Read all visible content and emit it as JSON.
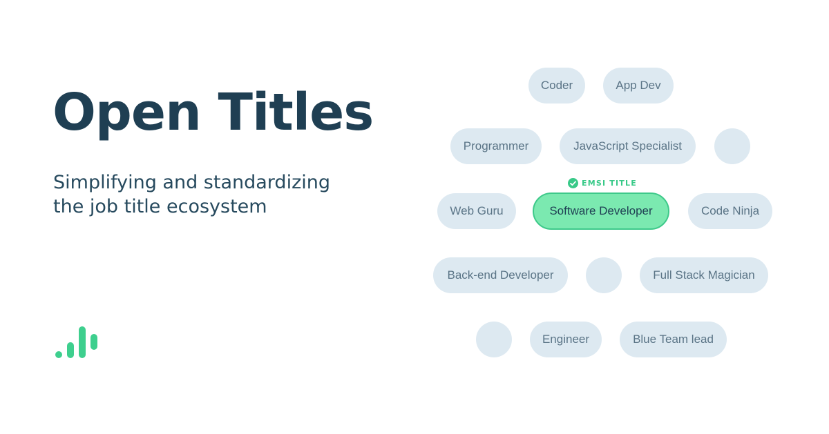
{
  "title": "Open Titles",
  "subtitle": {
    "line1": "Simplifying and standardizing",
    "line2": "the job title ecosystem"
  },
  "colors": {
    "title": "#1f3f53",
    "chip_background": "#dde9f1",
    "chip_text": "#5a7486",
    "featured_background": "#7be9b0",
    "featured_border": "#3ec98a",
    "accent": "#38c988"
  },
  "logo": {
    "icon": "bar-chart-logo-icon"
  },
  "emsi_badge": {
    "icon": "check-circle-icon",
    "label": "EMSI TITLE"
  },
  "chips": {
    "coder": "Coder",
    "app_dev": "App Dev",
    "programmer": "Programmer",
    "javascript_specialist": "JavaScript Specialist",
    "web_guru": "Web Guru",
    "software_developer": "Software Developer",
    "code_ninja": "Code Ninja",
    "back_end_developer": "Back-end Developer",
    "full_stack_magician": "Full Stack Magician",
    "engineer": "Engineer",
    "blue_team_lead": "Blue Team lead"
  }
}
